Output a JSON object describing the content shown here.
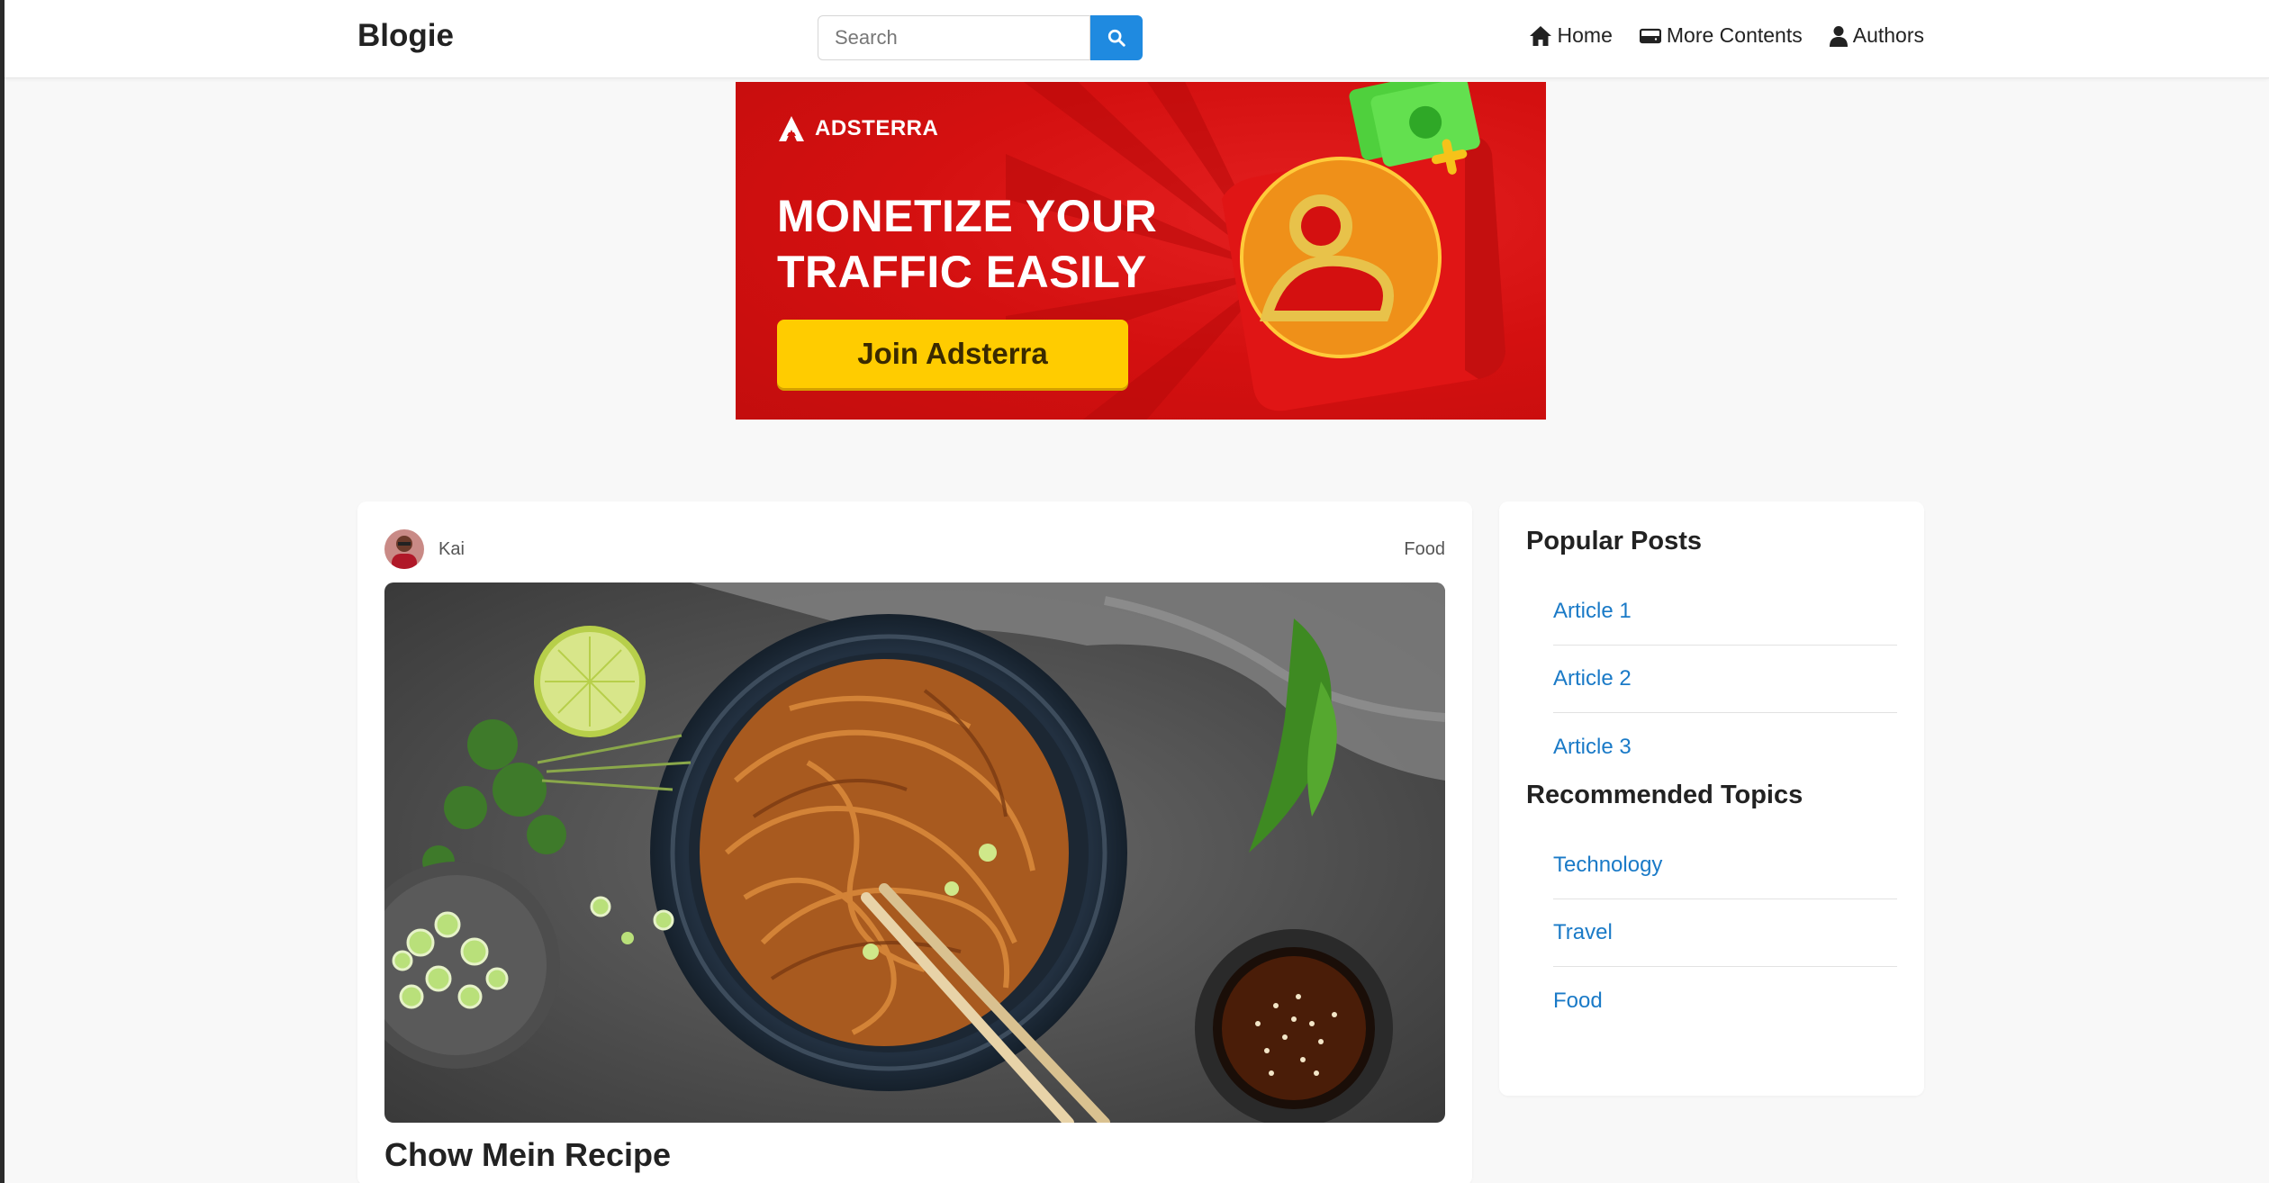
{
  "navbar": {
    "brand": "Blogie",
    "search_placeholder": "Search",
    "links": [
      {
        "label": "Home",
        "icon": "home-icon"
      },
      {
        "label": "More Contents",
        "icon": "drive-icon"
      },
      {
        "label": "Authors",
        "icon": "user-icon"
      }
    ],
    "accent_color": "#1f8ae0"
  },
  "ad": {
    "logo_text": "ADSTERRA",
    "headline_line1": "MONETIZE YOUR",
    "headline_line2": "TRAFFIC EASILY",
    "button_label": "Join Adsterra",
    "background_color": "#d41010",
    "button_color": "#ffcc00"
  },
  "post": {
    "author": "Kai",
    "category": "Food",
    "title": "Chow Mein Recipe",
    "image_description_icon": "food-photo"
  },
  "sidebar": {
    "popular_title": "Popular Posts",
    "popular": [
      "Article 1",
      "Article 2",
      "Article 3"
    ],
    "topics_title": "Recommended Topics",
    "topics": [
      "Technology",
      "Travel",
      "Food"
    ],
    "link_color": "#1a7ac7"
  }
}
